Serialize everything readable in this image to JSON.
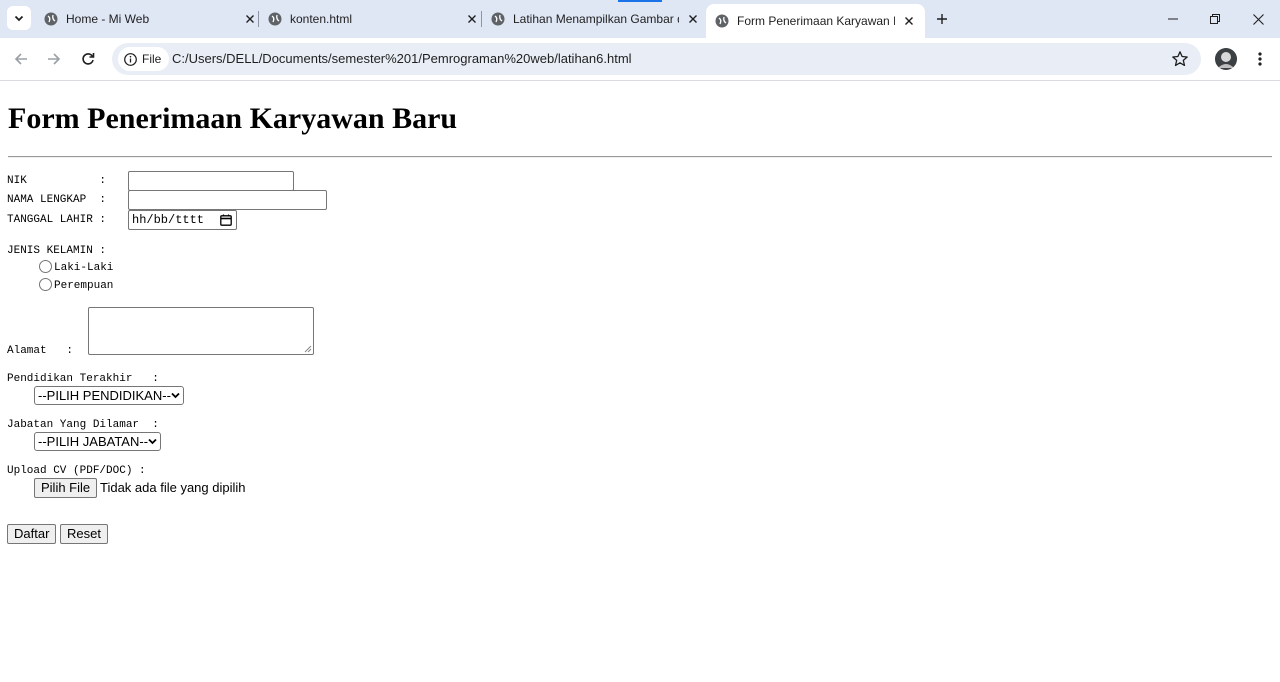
{
  "browser": {
    "tabs": [
      {
        "title": "Home - Mi Web",
        "active": false
      },
      {
        "title": "konten.html",
        "active": false
      },
      {
        "title": "Latihan Menampilkan Gambar d",
        "active": false
      },
      {
        "title": "Form Penerimaan Karyawan Bar",
        "active": true
      }
    ],
    "address_chip": "File",
    "url": "C:/Users/DELL/Documents/semester%201/Pemrograman%20web/latihan6.html",
    "accent_color": "#1a73e8",
    "tabstrip_color": "#dfe6f4"
  },
  "form": {
    "heading": "Form Penerimaan Karyawan Baru",
    "nik_label": "NIK           :",
    "nama_label": "NAMA LENGKAP  :",
    "tanggal_label": "TANGGAL LAHIR :",
    "tanggal_placeholder": "hh/bb/tttt",
    "jenis_kelamin_label": "JENIS KELAMIN :",
    "gender_options": [
      "Laki-Laki",
      "Perempuan"
    ],
    "alamat_label": "Alamat   :",
    "pendidikan_label": "Pendidikan Terakhir   :",
    "pendidikan_selected": "--PILIH PENDIDIKAN--",
    "jabatan_label": "Jabatan Yang Dilamar  :",
    "jabatan_selected": "--PILIH JABATAN--",
    "upload_label": "Upload CV (PDF/DOC) :",
    "file_button": "Pilih File",
    "file_status": "Tidak ada file yang dipilih",
    "submit_button": "Daftar",
    "reset_button": "Reset"
  }
}
